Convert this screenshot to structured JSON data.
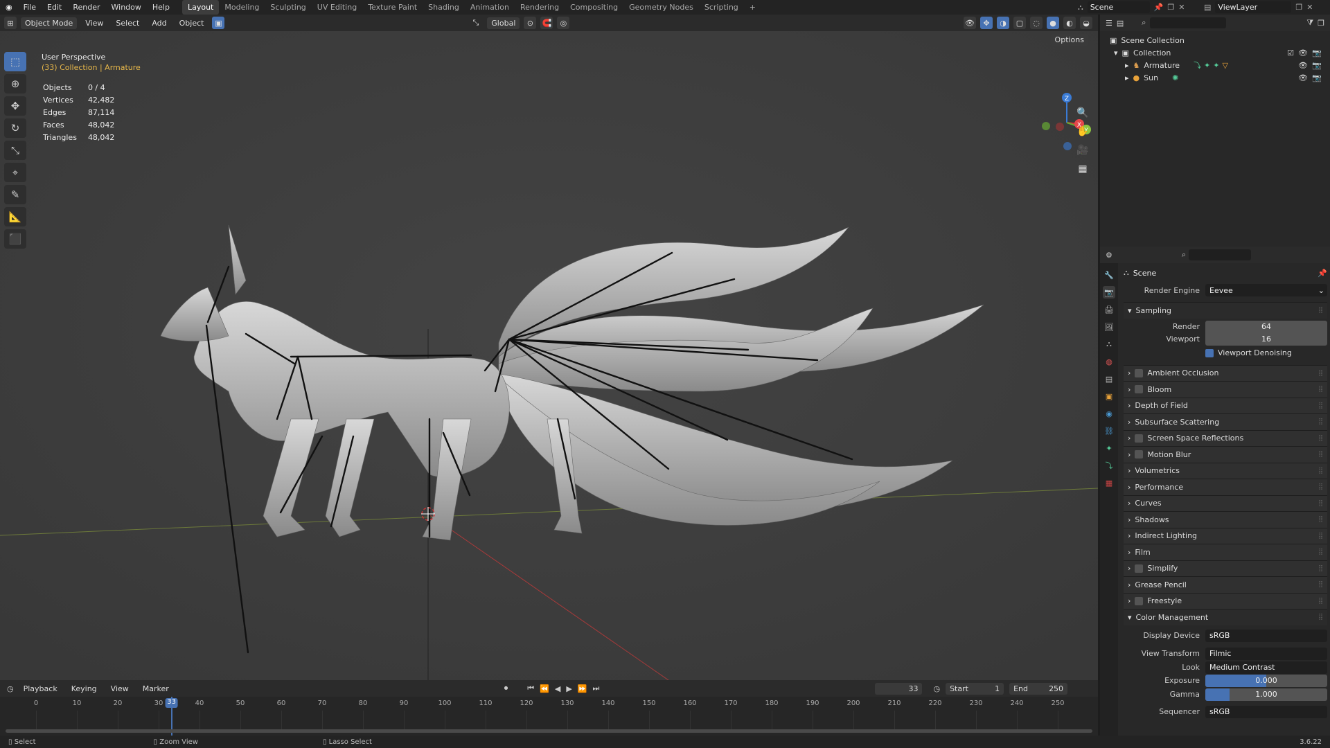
{
  "topbar": {
    "menus": [
      "File",
      "Edit",
      "Render",
      "Window",
      "Help"
    ],
    "workspaces": [
      "Layout",
      "Modeling",
      "Sculpting",
      "UV Editing",
      "Texture Paint",
      "Shading",
      "Animation",
      "Rendering",
      "Compositing",
      "Geometry Nodes",
      "Scripting"
    ],
    "active_workspace": "Layout",
    "add_tab": "+",
    "scene": "Scene",
    "view_layer": "ViewLayer"
  },
  "viewport_header": {
    "mode": "Object Mode",
    "menus": [
      "View",
      "Select",
      "Add",
      "Object"
    ],
    "orientation": "Global",
    "options": "Options"
  },
  "viewport": {
    "view_name": "User Perspective",
    "collection_line": "(33) Collection | Armature",
    "stats": [
      {
        "label": "Objects",
        "value": "0 / 4"
      },
      {
        "label": "Vertices",
        "value": "42,482"
      },
      {
        "label": "Edges",
        "value": "87,114"
      },
      {
        "label": "Faces",
        "value": "48,042"
      },
      {
        "label": "Triangles",
        "value": "48,042"
      }
    ],
    "gizmo_axes": {
      "z": "Z",
      "x": "X",
      "y": "Y"
    }
  },
  "outliner": {
    "root": "Scene Collection",
    "collection": "Collection",
    "items": [
      "Armature",
      "Sun"
    ]
  },
  "properties": {
    "title": "Scene",
    "render_engine_label": "Render Engine",
    "render_engine": "Eevee",
    "sampling": {
      "title": "Sampling",
      "render_label": "Render",
      "render_value": "64",
      "viewport_label": "Viewport",
      "viewport_value": "16",
      "denoise_label": "Viewport Denoising"
    },
    "panels": [
      {
        "label": "Ambient Occlusion",
        "checkbox": true
      },
      {
        "label": "Bloom",
        "checkbox": true
      },
      {
        "label": "Depth of Field",
        "checkbox": false
      },
      {
        "label": "Subsurface Scattering",
        "checkbox": false
      },
      {
        "label": "Screen Space Reflections",
        "checkbox": true
      },
      {
        "label": "Motion Blur",
        "checkbox": true
      },
      {
        "label": "Volumetrics",
        "checkbox": false
      },
      {
        "label": "Performance",
        "checkbox": false
      },
      {
        "label": "Curves",
        "checkbox": false
      },
      {
        "label": "Shadows",
        "checkbox": false
      },
      {
        "label": "Indirect Lighting",
        "checkbox": false
      },
      {
        "label": "Film",
        "checkbox": false
      },
      {
        "label": "Simplify",
        "checkbox": true
      },
      {
        "label": "Grease Pencil",
        "checkbox": false
      },
      {
        "label": "Freestyle",
        "checkbox": true
      }
    ],
    "color_management": {
      "title": "Color Management",
      "display_device_label": "Display Device",
      "display_device": "sRGB",
      "view_transform_label": "View Transform",
      "view_transform": "Filmic",
      "look_label": "Look",
      "look": "Medium Contrast",
      "exposure_label": "Exposure",
      "exposure": "0.000",
      "gamma_label": "Gamma",
      "gamma": "1.000",
      "sequencer_label": "Sequencer",
      "sequencer": "sRGB"
    }
  },
  "timeline": {
    "menus": [
      "Playback",
      "Keying",
      "View",
      "Marker"
    ],
    "current_frame": "33",
    "start_label": "Start",
    "start": "1",
    "end_label": "End",
    "end": "250",
    "ticks": [
      "0",
      "10",
      "20",
      "30",
      "40",
      "50",
      "60",
      "70",
      "80",
      "90",
      "100",
      "110",
      "120",
      "130",
      "140",
      "150",
      "160",
      "170",
      "180",
      "190",
      "200",
      "210",
      "220",
      "230",
      "240",
      "250"
    ]
  },
  "statusbar": {
    "select": "Select",
    "zoom": "Zoom View",
    "lasso": "Lasso Select",
    "version": "3.6.22"
  }
}
